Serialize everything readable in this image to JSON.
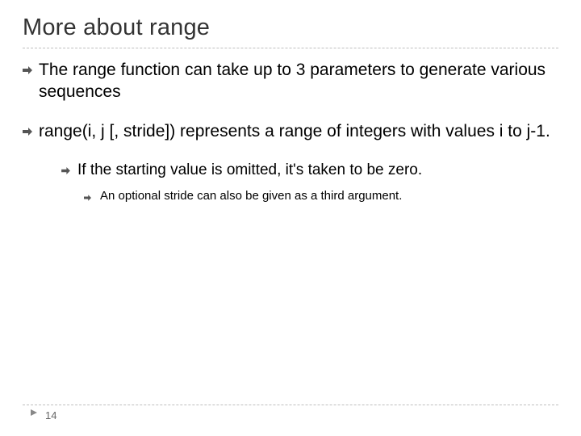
{
  "title": "More about range",
  "bullets": {
    "b1a": "The range function can take up to 3 parameters to generate various sequences",
    "b1b": " range(i, j [, stride]) represents a range of integers with values i to j-1.",
    "b2a": "If the starting value is omitted, it's taken to be zero.",
    "b3a": "An optional stride can also be given as a third argument."
  },
  "page_number": "14",
  "markers": {
    "level1": "⤖",
    "level2": "⤖",
    "level3": "⤖"
  }
}
